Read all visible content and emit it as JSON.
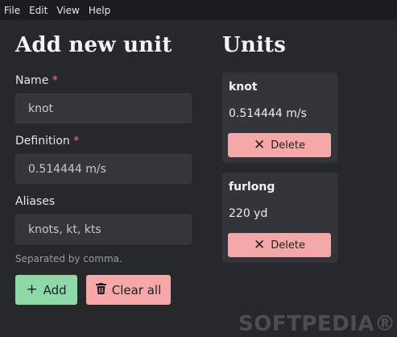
{
  "menu": [
    "File",
    "Edit",
    "View",
    "Help"
  ],
  "form": {
    "title": "Add new unit",
    "name_label": "Name",
    "name_value": "knot",
    "definition_label": "Definition",
    "definition_value": "0.514444 m/s",
    "aliases_label": "Aliases",
    "aliases_value": "knots, kt, kts",
    "required_marker": "*",
    "hint": "Separated by comma.",
    "add_label": "Add",
    "clear_label": "Clear all"
  },
  "units": {
    "title": "Units",
    "items": [
      {
        "name": "knot",
        "value": "0.514444 m/s",
        "delete_label": "Delete"
      },
      {
        "name": "furlong",
        "value": "220 yd",
        "delete_label": "Delete"
      }
    ]
  },
  "watermark": "SOFTPEDIA®"
}
